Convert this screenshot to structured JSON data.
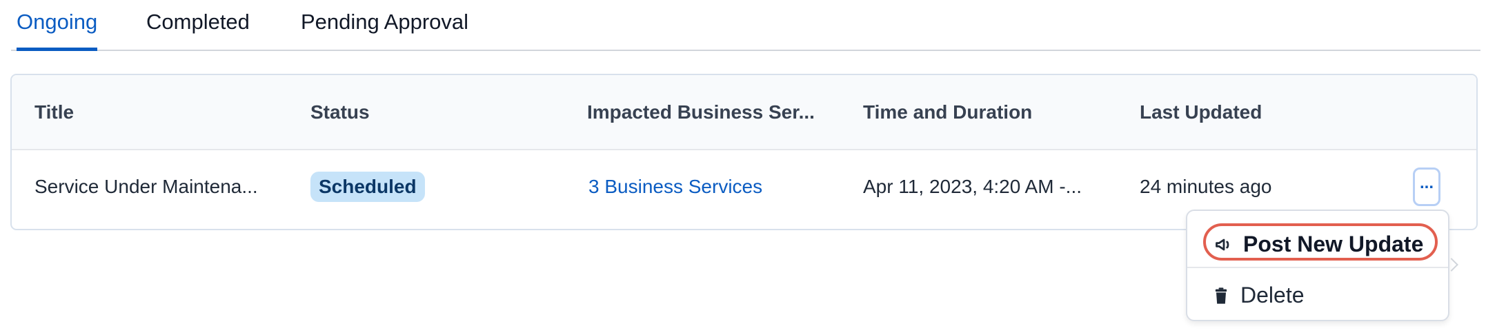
{
  "tabs": [
    {
      "label": "Ongoing"
    },
    {
      "label": "Completed"
    },
    {
      "label": "Pending Approval"
    }
  ],
  "table": {
    "headers": [
      "Title",
      "Status",
      "Impacted Business Ser...",
      "Time and Duration",
      "Last Updated"
    ],
    "rows": [
      {
        "title": "Service Under Maintena...",
        "status": "Scheduled",
        "impacted": "3 Business Services",
        "time": "Apr 11, 2023, 4:20 AM -...",
        "last_updated": "24 minutes ago"
      }
    ],
    "row_actions_label": "..."
  },
  "menu": {
    "items": [
      {
        "label": "Post New Update",
        "icon": "megaphone-icon"
      },
      {
        "label": "Delete",
        "icon": "trash-icon"
      }
    ]
  },
  "colors": {
    "accent": "#0b5cc2",
    "badge_bg": "#c6e3f9",
    "highlight": "#e25f4f"
  }
}
